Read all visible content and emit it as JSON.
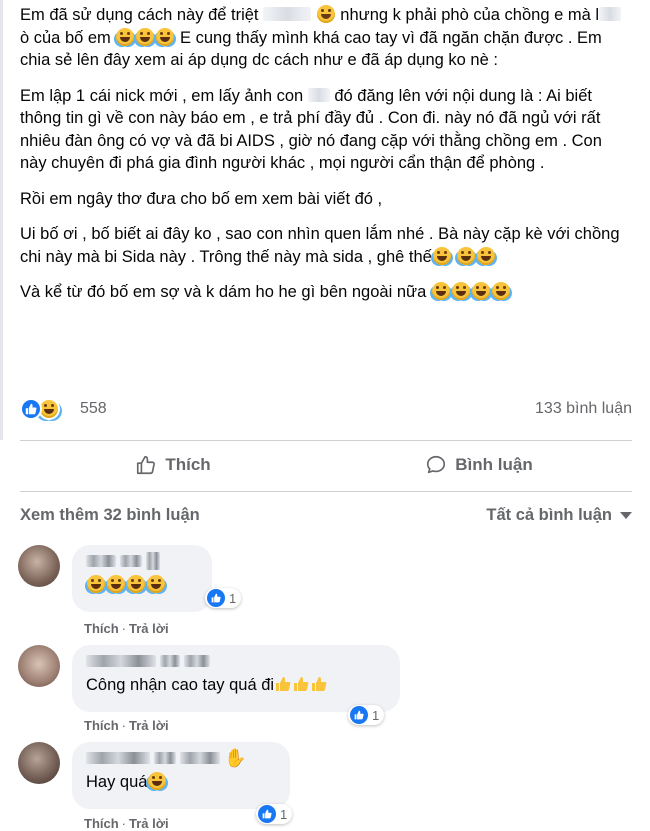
{
  "post": {
    "p1_a": "Em đã sử dụng cách này để triệt",
    "p1_b": "nhưng k phải phò của chồng e mà l",
    "p1_c": "ò của bố em",
    "p1_d": "E cung thấy mình khá cao tay vì đã ngăn chặn được . Em chia sẻ lên đây xem ai áp dụng dc cách như e đã áp   dụng ko nè :",
    "p2_a": "Em lập 1 cái nick mới , em lấy ảnh con",
    "p2_b": "đó đăng lên với nội dung là : Ai biết thông tin gì về con này báo em , e trả phí đầy đủ . Con đi. này nó đã ngủ với rất nhiêu đàn ông có vợ và đã bi AIDS , giờ nó đang cặp với thằng chồng em . Con này chuyên đi phá gia đình người khác , mọi người cẩn thận để phòng .",
    "p3": "Rồi em ngây thơ đưa cho bố em xem bài viết đó ,",
    "p4": "Ui bố ơi , bố biết ai đây ko , sao con nhìn quen lắm nhé . Bà này cặp kè với chồng chi này mà bi Sida này . Trông thế này mà sida , ghê thế",
    "p5": "Và kể từ đó bố em sợ và k dám ho he gì bên ngoài nữa"
  },
  "stats": {
    "reaction_count": "558",
    "comment_count": "133 bình luận"
  },
  "actions": {
    "like_label": "Thích",
    "comment_label": "Bình luận"
  },
  "comments_header": {
    "view_more": "Xem thêm 32 bình luận",
    "filter": "Tất cả bình luận"
  },
  "comments": [
    {
      "text": "",
      "like_count": "1",
      "like_label": "Thích",
      "reply_label": "Trả lời"
    },
    {
      "text": "Công nhận cao tay quá đi",
      "like_count": "1",
      "like_label": "Thích",
      "reply_label": "Trả lời"
    },
    {
      "text": "Hay quá",
      "like_count": "1",
      "like_label": "Thích",
      "reply_label": "Trả lời"
    }
  ],
  "colors": {
    "brand_blue": "#1877f2",
    "muted_text": "#65676b",
    "bubble_bg": "#f0f2f5"
  },
  "icons": [
    "like-reaction-icon",
    "haha-reaction-icon",
    "thumbs-up-icon",
    "comment-icon",
    "caret-down-icon",
    "wave-icon"
  ]
}
